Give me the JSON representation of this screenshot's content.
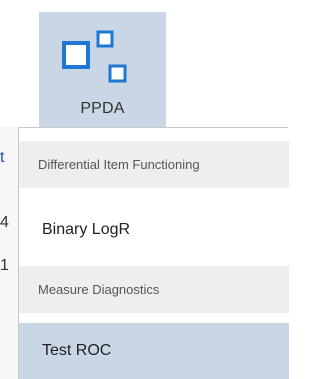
{
  "ribbon": {
    "button_label": "PPDA",
    "icon": "ppda-squares-icon",
    "accent": "#1e78d2",
    "selected_bg": "#c9d6e6"
  },
  "background_fragments": [
    "t",
    "4",
    "1"
  ],
  "menu": {
    "sections": [
      {
        "header": "Differential Item Functioning",
        "items": [
          {
            "label": "Binary LogR"
          }
        ]
      },
      {
        "header": "Measure Diagnostics",
        "items": [
          {
            "label": "Test ROC",
            "highlighted": true
          }
        ]
      }
    ]
  }
}
